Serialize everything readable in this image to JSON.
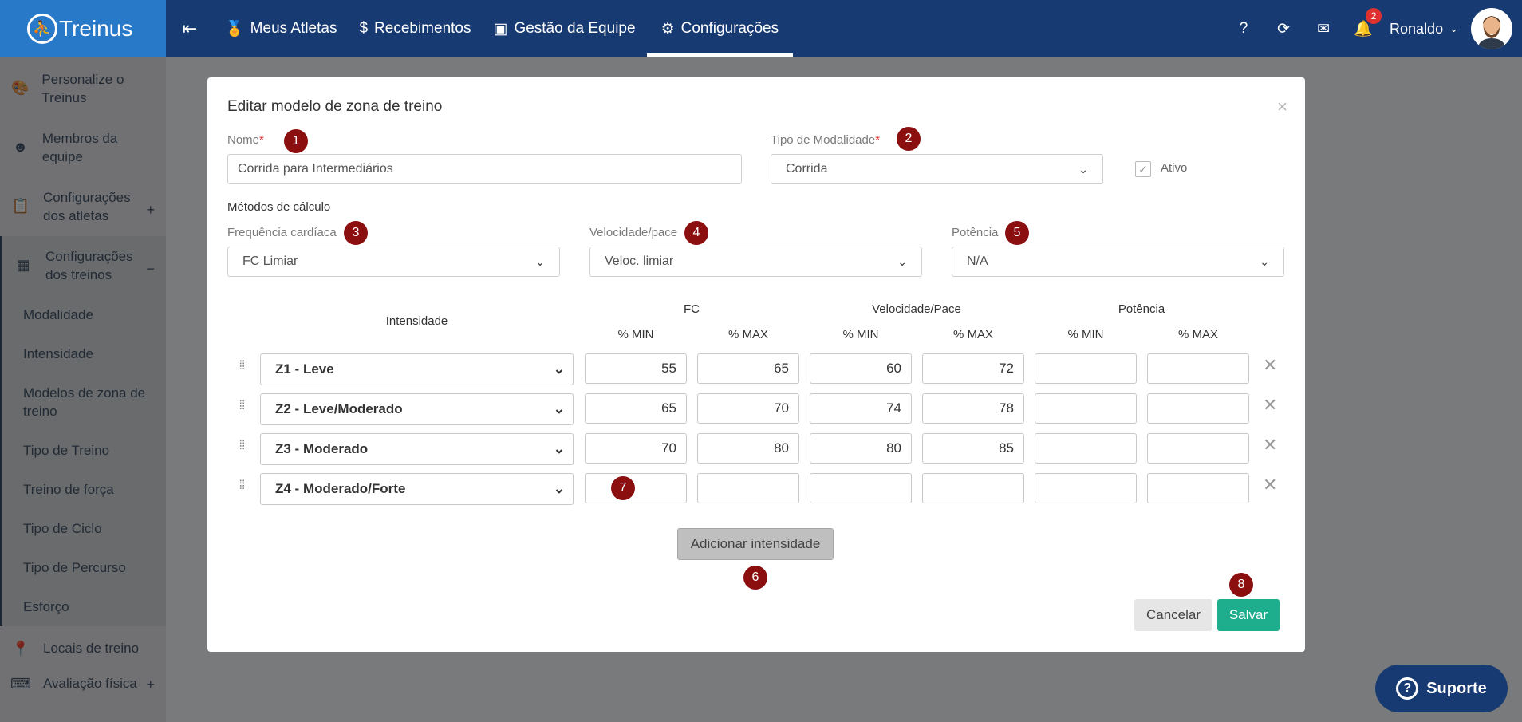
{
  "brand": {
    "name": "Treinus"
  },
  "nav": {
    "items": [
      {
        "label": "Meus Atletas",
        "icon": "medal-icon"
      },
      {
        "label": "Recebimentos",
        "icon": "dollar-icon"
      },
      {
        "label": "Gestão da Equipe",
        "icon": "id-badge-icon"
      },
      {
        "label": "Configurações",
        "icon": "gears-icon",
        "active": true
      }
    ],
    "right": {
      "help": "?",
      "notifications_count": "2",
      "user_name": "Ronaldo"
    }
  },
  "sidebar": {
    "items": [
      {
        "label": "Personalize o Treinus",
        "icon": "palette-icon"
      },
      {
        "label": "Membros da equipe",
        "icon": "team-icon"
      },
      {
        "label": "Configurações dos atletas",
        "icon": "clipboard-icon",
        "toggle": "+"
      },
      {
        "label": "Configurações dos treinos",
        "icon": "table-gear-icon",
        "toggle": "−"
      }
    ],
    "subitems": [
      "Modalidade",
      "Intensidade",
      "Modelos de zona de treino",
      "Tipo de Treino",
      "Treino de força",
      "Tipo de Ciclo",
      "Tipo de Percurso",
      "Esforço"
    ],
    "bottom": [
      {
        "label": "Locais de treino",
        "icon": "map-pin-icon"
      },
      {
        "label": "Avaliação física",
        "icon": "keyboard-icon",
        "toggle": "+"
      }
    ]
  },
  "modal": {
    "title": "Editar modelo de zona de treino",
    "nome_label": "Nome",
    "nome_value": "Corrida para Intermediários",
    "modalidade_label": "Tipo de Modalidade",
    "modalidade_value": "Corrida",
    "ativo_label": "Ativo",
    "metodos_label": "Métodos de cálculo",
    "fc_label": "Frequência cardíaca",
    "fc_value": "FC Limiar",
    "vel_label": "Velocidade/pace",
    "vel_value": "Veloc. limiar",
    "pot_label": "Potência",
    "pot_value": "N/A",
    "table": {
      "intensidade_header": "Intensidade",
      "fc_header": "FC",
      "vel_header": "Velocidade/Pace",
      "pot_header": "Potência",
      "min": "% MIN",
      "max": "% MAX",
      "rows": [
        {
          "zone": "Z1 - Leve",
          "fc_min": "55",
          "fc_max": "65",
          "vel_min": "60",
          "vel_max": "72",
          "pot_min": "",
          "pot_max": ""
        },
        {
          "zone": "Z2 - Leve/Moderado",
          "fc_min": "65",
          "fc_max": "70",
          "vel_min": "74",
          "vel_max": "78",
          "pot_min": "",
          "pot_max": ""
        },
        {
          "zone": "Z3 - Moderado",
          "fc_min": "70",
          "fc_max": "80",
          "vel_min": "80",
          "vel_max": "85",
          "pot_min": "",
          "pot_max": ""
        },
        {
          "zone": "Z4 - Moderado/Forte",
          "fc_min": "",
          "fc_max": "",
          "vel_min": "",
          "vel_max": "",
          "pot_min": "",
          "pot_max": ""
        }
      ]
    },
    "add_label": "Adicionar intensidade",
    "cancel_label": "Cancelar",
    "save_label": "Salvar"
  },
  "markers": [
    "1",
    "2",
    "3",
    "4",
    "5",
    "6",
    "7",
    "8"
  ],
  "support_label": "Suporte",
  "colors": {
    "navbar": "#163a71",
    "brand": "#2979c9",
    "save": "#1eae8e",
    "marker": "#8b0f0f"
  }
}
